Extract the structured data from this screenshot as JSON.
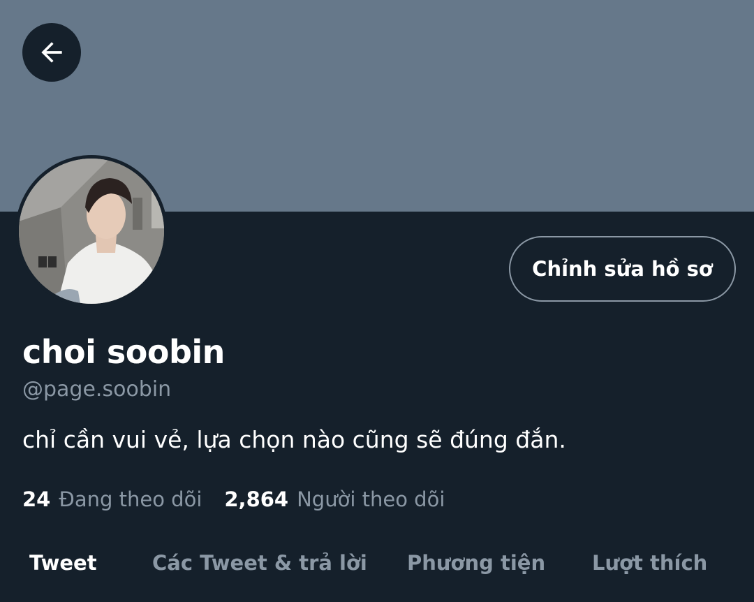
{
  "profile": {
    "display_name": "choi soobin",
    "handle": "@page.soobin",
    "bio": "chỉ cần vui vẻ, lựa chọn nào cũng sẽ đúng đắn.",
    "edit_button_label": "Chỉnh sửa hồ sơ"
  },
  "stats": {
    "following_count": "24",
    "following_label": "Đang theo dõi",
    "followers_count": "2,864",
    "followers_label": "Người theo dõi"
  },
  "tabs": [
    {
      "label": "Tweet",
      "active": true
    },
    {
      "label": "Các Tweet & trả lời",
      "active": false
    },
    {
      "label": "Phương tiện",
      "active": false
    },
    {
      "label": "Lượt thích",
      "active": false
    }
  ],
  "icons": {
    "back": "arrow-left-icon"
  },
  "colors": {
    "background": "#15202b",
    "banner": "#66788a",
    "text_primary": "#ffffff",
    "text_secondary": "#8b98a5"
  }
}
